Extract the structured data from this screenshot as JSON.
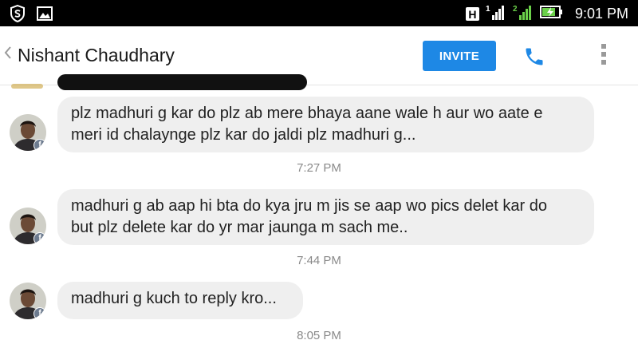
{
  "status_bar": {
    "time": "9:01 PM",
    "icons": [
      "shield-icon",
      "image-icon",
      "h-signal-icon",
      "signal-1-icon",
      "signal-2-icon",
      "battery-charging-icon"
    ],
    "h_label": "H"
  },
  "header": {
    "contact_name": "Nishant Chaudhary",
    "invite_label": "INVITE",
    "accent": "#1e88e5"
  },
  "messages": [
    {
      "text": "plz madhuri g kar do plz ab mere bhaya aane wale h aur wo aate e\nmeri id chalaynge plz kar do jaldi plz madhuri g...",
      "time": "7:27 PM"
    },
    {
      "text": "madhuri g ab aap hi bta do kya jru m jis se aap wo pics delet kar do\nbut plz delete kar do yr mar jaunga m sach me..",
      "time": "7:44 PM"
    },
    {
      "text": "madhuri g kuch to reply kro...",
      "time": "8:05 PM"
    }
  ],
  "badge_letter": "f"
}
